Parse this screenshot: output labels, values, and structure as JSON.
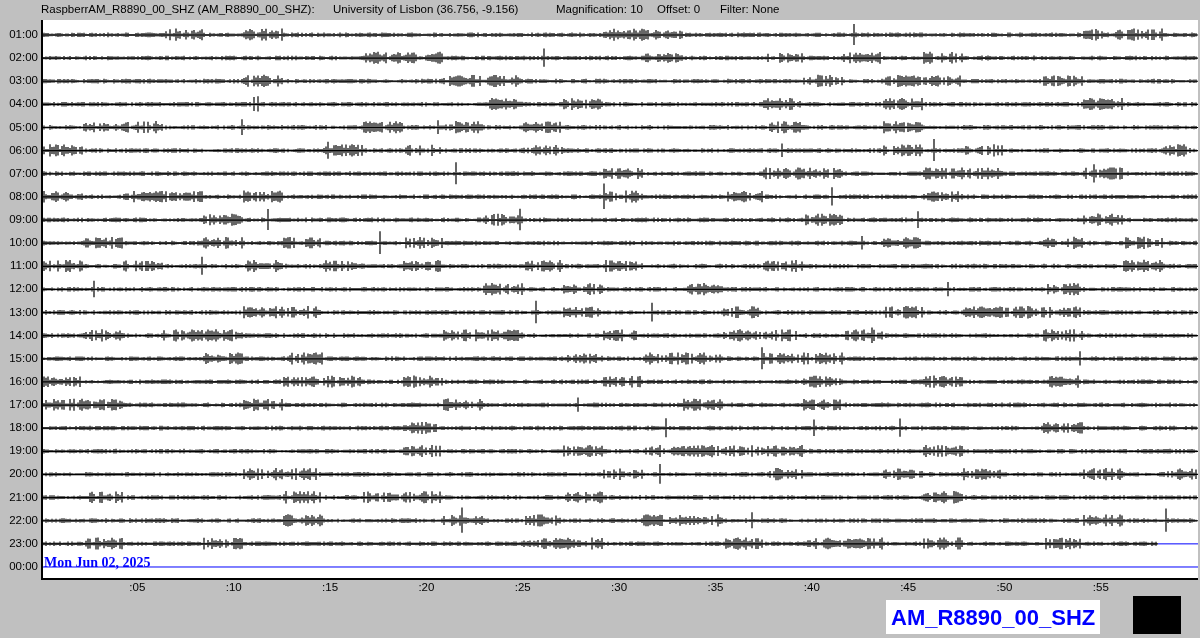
{
  "header": {
    "station": "RaspberrAM_R8890_00_SHZ (AM_R8890_00_SHZ):",
    "location": "University of Lisbon (36.756, -9.156)",
    "magnification": "Magnification: 10",
    "offset": "Offset: 0",
    "filter": "Filter: None"
  },
  "rows": [
    {
      "time": "01:00",
      "kind": "trace"
    },
    {
      "time": "02:00",
      "kind": "trace"
    },
    {
      "time": "03:00",
      "kind": "trace"
    },
    {
      "time": "04:00",
      "kind": "trace"
    },
    {
      "time": "05:00",
      "kind": "trace"
    },
    {
      "time": "06:00",
      "kind": "trace"
    },
    {
      "time": "07:00",
      "kind": "trace"
    },
    {
      "time": "08:00",
      "kind": "trace"
    },
    {
      "time": "09:00",
      "kind": "trace"
    },
    {
      "time": "10:00",
      "kind": "trace"
    },
    {
      "time": "11:00",
      "kind": "trace"
    },
    {
      "time": "12:00",
      "kind": "trace"
    },
    {
      "time": "13:00",
      "kind": "trace"
    },
    {
      "time": "14:00",
      "kind": "trace"
    },
    {
      "time": "15:00",
      "kind": "trace"
    },
    {
      "time": "16:00",
      "kind": "trace"
    },
    {
      "time": "17:00",
      "kind": "trace"
    },
    {
      "time": "18:00",
      "kind": "trace"
    },
    {
      "time": "19:00",
      "kind": "trace"
    },
    {
      "time": "20:00",
      "kind": "trace"
    },
    {
      "time": "21:00",
      "kind": "trace"
    },
    {
      "time": "22:00",
      "kind": "trace"
    },
    {
      "time": "23:00",
      "kind": "partial"
    },
    {
      "time": "00:00",
      "kind": "empty"
    }
  ],
  "date_label": "Mon Jun 02, 2025",
  "x_ticks": [
    ":05",
    ":10",
    ":15",
    ":20",
    ":25",
    ":30",
    ":35",
    ":40",
    ":45",
    ":50",
    ":55"
  ],
  "channel_label": "AM_R8890_00_SHZ"
}
